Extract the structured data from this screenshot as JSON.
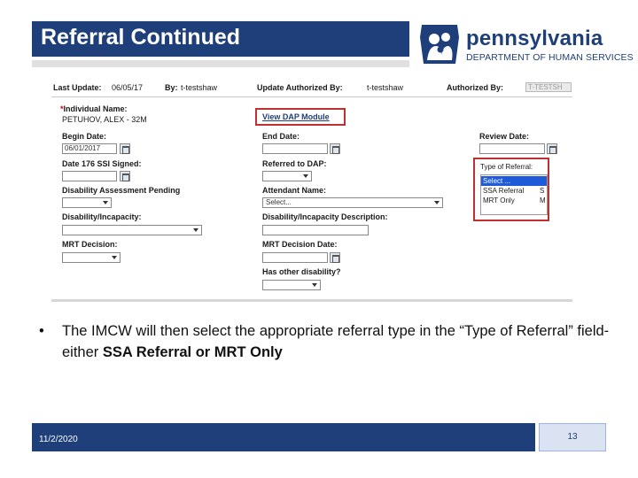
{
  "header": {
    "title": "Referral Continued"
  },
  "logo": {
    "name": "pennsylvania",
    "department": "DEPARTMENT OF HUMAN SERVICES"
  },
  "screenshot": {
    "meta": {
      "last_update_label": "Last Update:",
      "last_update_value": "06/05/17",
      "by_label": "By:",
      "by_value": "t-testshaw",
      "update_authorized_label": "Update Authorized By:",
      "update_authorized_value": "t-testshaw",
      "authorized_by_label": "Authorized By:",
      "authorized_by_value": "T-TESTSH"
    },
    "individual_name_label": "Individual Name:",
    "individual_name_value": "PETUHOV, ALEX - 32M",
    "view_dap_link": "View DAP Module",
    "begin_date_label": "Begin Date:",
    "begin_date_value": "06/01/2017",
    "end_date_label": "End Date:",
    "review_date_label": "Review Date:",
    "date_176_label": "Date 176 SSI Signed:",
    "referred_dap_label": "Referred to DAP:",
    "type_of_referral": {
      "label": "Type of Referral:",
      "options": [
        {
          "label": "Select ...",
          "key": ""
        },
        {
          "label": "SSA Referral",
          "key": "S"
        },
        {
          "label": "MRT Only",
          "key": "M"
        }
      ]
    },
    "disability_assessment_label": "Disability Assessment Pending",
    "attendant_name_label": "Attendant Name:",
    "attendant_placeholder": "Select...",
    "disability_incapacity_label": "Disability/Incapacity:",
    "disability_incapacity_desc_label": "Disability/Incapacity Description:",
    "mrt_decision_label": "MRT Decision:",
    "mrt_decision_date_label": "MRT Decision Date:",
    "has_other_disability_label": "Has other disability?"
  },
  "bullet": {
    "text_before": "The IMCW will then select the appropriate referral type in the “Type of Referral” field-either ",
    "text_bold": "SSA Referral or MRT Only"
  },
  "footer": {
    "date": "11/2/2020",
    "page": "13"
  },
  "colors": {
    "brand_blue": "#1f3f7a",
    "highlight_red": "#c03030",
    "select_blue": "#1f5ad8"
  }
}
